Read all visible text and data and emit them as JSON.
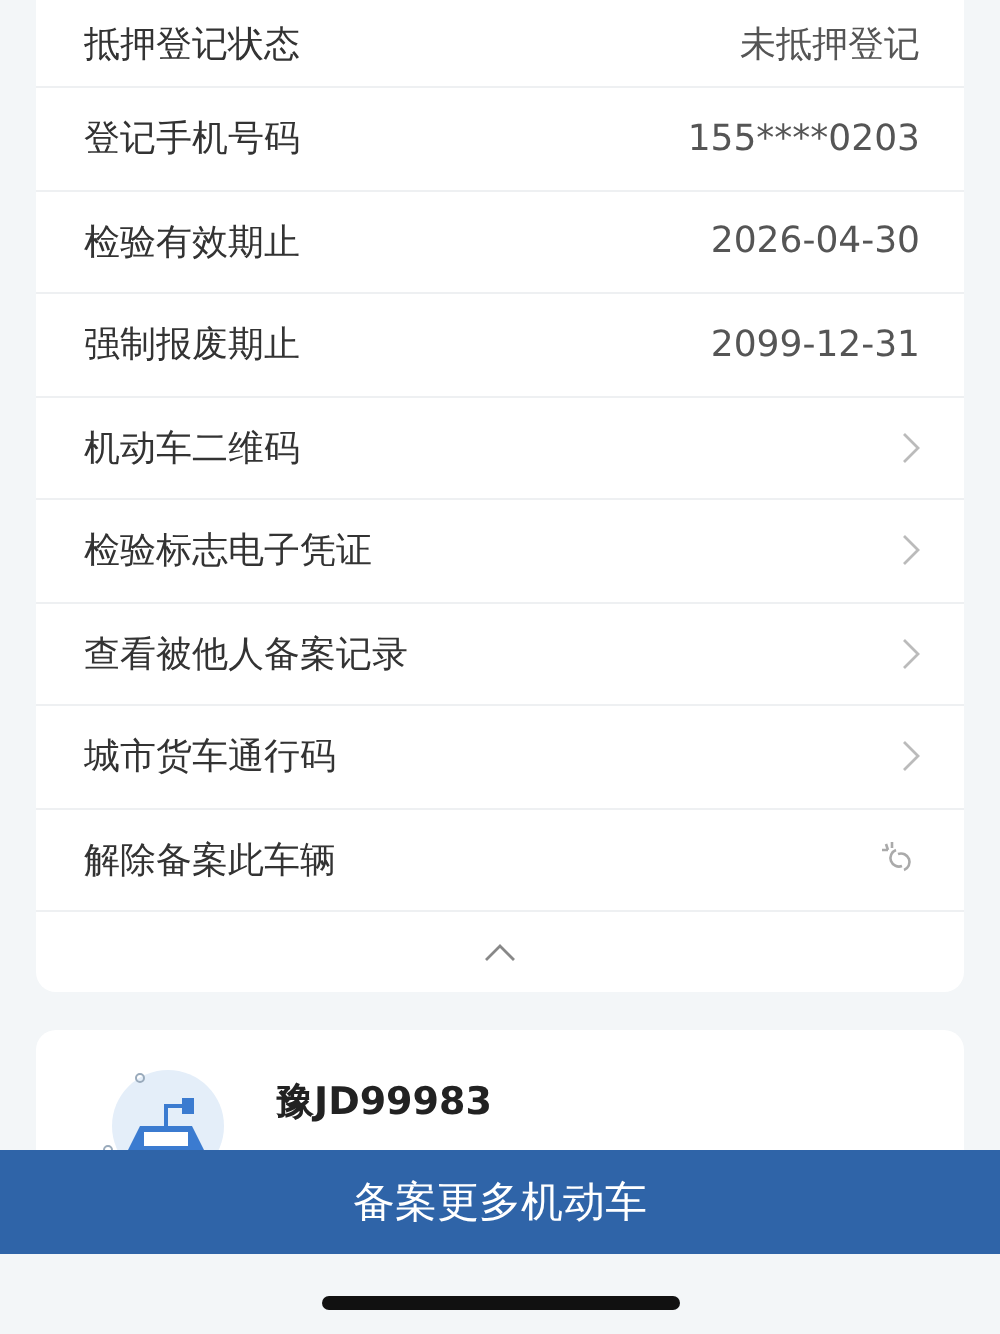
{
  "detail_rows": [
    {
      "kind": "value",
      "label": "抵押登记状态",
      "value": "未抵押登记"
    },
    {
      "kind": "value",
      "label": "登记手机号码",
      "value": "155****0203"
    },
    {
      "kind": "value",
      "label": "检验有效期止",
      "value": "2026-04-30"
    },
    {
      "kind": "value",
      "label": "强制报废期止",
      "value": "2099-12-31"
    },
    {
      "kind": "link",
      "label": "机动车二维码"
    },
    {
      "kind": "link",
      "label": "检验标志电子凭证"
    },
    {
      "kind": "link",
      "label": "查看被他人备案记录"
    },
    {
      "kind": "link",
      "label": "城市货车通行码"
    },
    {
      "kind": "unbind",
      "label": "解除备案此车辆"
    }
  ],
  "vehicle": {
    "plate": "豫JD99983"
  },
  "bottom_button": {
    "label": "备案更多机动车"
  }
}
